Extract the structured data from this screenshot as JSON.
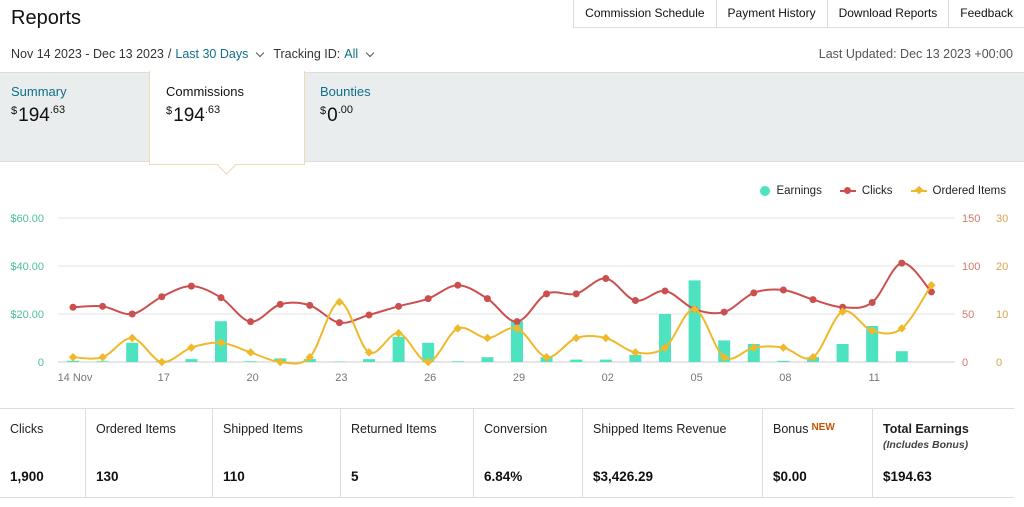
{
  "page": {
    "title": "Reports"
  },
  "top_tabs": [
    "Commission Schedule",
    "Payment History",
    "Download Reports",
    "Feedback"
  ],
  "filters": {
    "date_range": "Nov 14 2023 - Dec 13 2023",
    "separator": "/",
    "range_preset": "Last 30 Days",
    "tracking_label": "Tracking ID:",
    "tracking_value": "All",
    "last_updated": "Last Updated: Dec 13 2023 +00:00"
  },
  "summary_tabs": [
    {
      "label": "Summary",
      "currency": "$",
      "whole": "194",
      "cents": ".63"
    },
    {
      "label": "Commissions",
      "currency": "$",
      "whole": "194",
      "cents": ".63",
      "active": true
    },
    {
      "label": "Bounties",
      "currency": "$",
      "whole": "0",
      "cents": ".00"
    }
  ],
  "legend": [
    {
      "label": "Earnings",
      "color": "#4de3c1",
      "marker": "dot"
    },
    {
      "label": "Clicks",
      "color": "#cc4f4f",
      "marker": "line-dot"
    },
    {
      "label": "Ordered Items",
      "color": "#f0b92c",
      "marker": "line-diamond"
    }
  ],
  "chart_data": {
    "type": "bar",
    "categories": [
      "14 Nov",
      "15",
      "16",
      "17",
      "18",
      "19",
      "20",
      "21",
      "22",
      "23",
      "24",
      "25",
      "26",
      "27",
      "28",
      "29",
      "30",
      "01",
      "02",
      "03",
      "04",
      "05",
      "06",
      "07",
      "08",
      "09",
      "10",
      "11",
      "12",
      "13"
    ],
    "x_tick_labels": [
      "14 Nov",
      "17",
      "20",
      "23",
      "26",
      "29",
      "02",
      "05",
      "08",
      "11"
    ],
    "y_left": {
      "ticks": [
        "$60.00",
        "$40.00",
        "$20.00",
        "0"
      ],
      "range": [
        0,
        60
      ],
      "color": "#4dbf9e"
    },
    "y_right1": {
      "ticks": [
        "150",
        "100",
        "50",
        "0"
      ],
      "range": [
        0,
        150
      ],
      "color": "#d27a6a"
    },
    "y_right2": {
      "ticks": [
        "30",
        "20",
        "10",
        "0"
      ],
      "range": [
        0,
        30
      ],
      "color": "#d9a44a"
    },
    "series": [
      {
        "name": "Earnings",
        "kind": "bar",
        "axis": "left",
        "color": "#4de3c1",
        "values": [
          0.5,
          0.3,
          8,
          0.5,
          1.2,
          17,
          0.3,
          1.5,
          1.3,
          0.2,
          1.2,
          10.5,
          8,
          0.3,
          2,
          17,
          2,
          1,
          1,
          3,
          20,
          34,
          9,
          7.5,
          0.5,
          2,
          7.5,
          15,
          4.5,
          0
        ]
      },
      {
        "name": "Clicks",
        "kind": "line",
        "axis": "right1",
        "color": "#cc4f4f",
        "values": [
          57,
          58,
          50,
          68,
          79,
          67,
          42,
          60,
          59,
          41,
          49,
          58,
          66,
          80,
          66,
          42,
          71,
          71,
          87,
          64,
          74,
          55,
          52,
          72,
          75,
          65,
          57,
          62,
          103,
          73
        ]
      },
      {
        "name": "Ordered Items",
        "kind": "line",
        "axis": "right2",
        "color": "#f0b92c",
        "values": [
          1,
          1,
          5,
          0,
          3,
          4,
          2,
          0,
          1,
          12.5,
          2,
          6,
          0,
          7,
          5,
          7,
          1,
          5,
          5,
          2,
          3,
          11,
          1,
          3,
          3,
          1,
          10.5,
          6.5,
          7,
          16
        ]
      }
    ],
    "grid": true
  },
  "stats": [
    {
      "label": "Clicks",
      "value": "1,900"
    },
    {
      "label": "Ordered Items",
      "value": "130"
    },
    {
      "label": "Shipped Items",
      "value": "110"
    },
    {
      "label": "Returned Items",
      "value": "5"
    },
    {
      "label": "Conversion",
      "value": "6.84%"
    },
    {
      "label": "Shipped Items Revenue",
      "value": "$3,426.29"
    },
    {
      "label": "Bonus",
      "badge": "NEW",
      "value": "$0.00"
    },
    {
      "label": "Total Earnings",
      "sub": "(Includes Bonus)",
      "value": "$194.63"
    }
  ]
}
